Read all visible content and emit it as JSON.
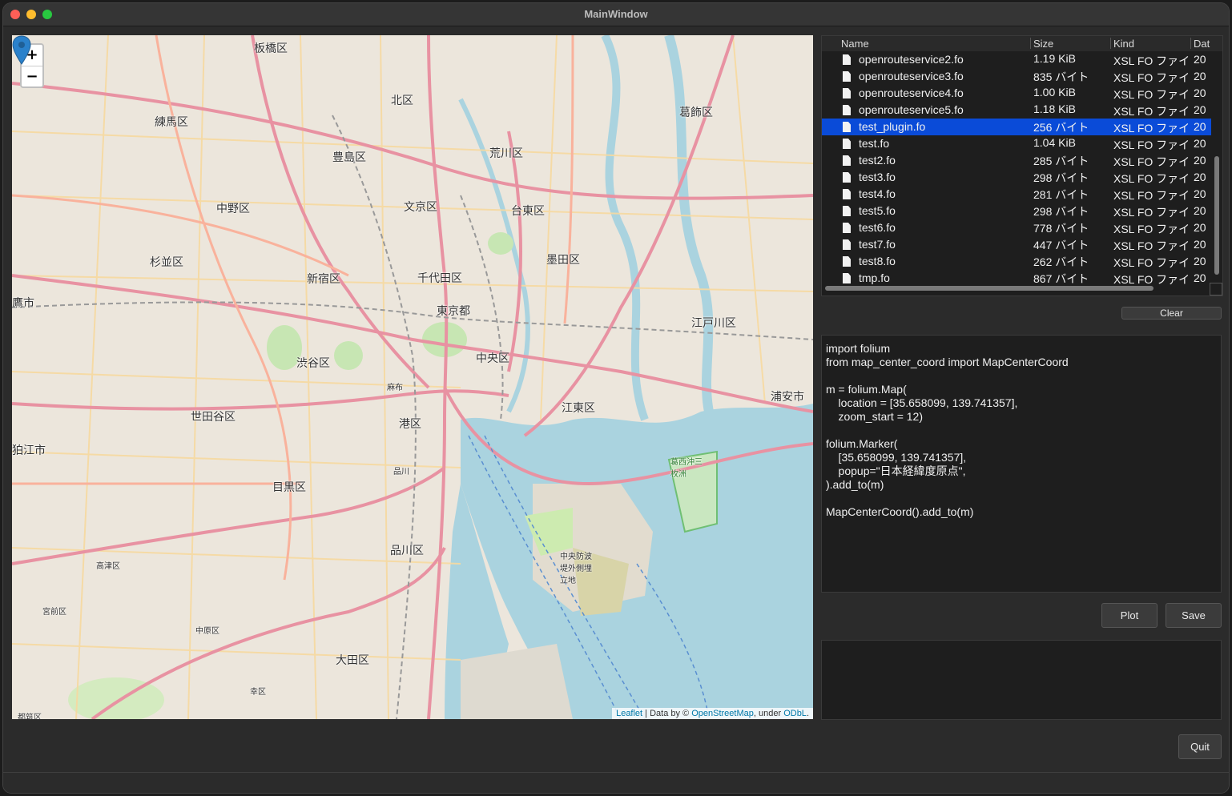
{
  "window": {
    "title": "MainWindow"
  },
  "map": {
    "zoom_in": "+",
    "zoom_out": "−",
    "labels": [
      "板橋区",
      "練馬区",
      "北区",
      "葛飾区",
      "豊島区",
      "荒川区",
      "中野区",
      "文京区",
      "台東区",
      "杉並区",
      "新宿区",
      "千代田区",
      "墨田区",
      "東京都",
      "鷹市",
      "江戸川区",
      "渋谷区",
      "中央区",
      "麻布",
      "港区",
      "江東区",
      "浦安市",
      "世田谷区",
      "狛江市",
      "目黒区",
      "品川",
      "品川区",
      "高津区",
      "宮前区",
      "中原区",
      "大田区",
      "幸区",
      "都筑区",
      "葛西沖三枚洲",
      "中央防波堤外側埋立地"
    ],
    "attribution": {
      "leaflet": "Leaflet",
      "mid": " | Data by © ",
      "osm": "OpenStreetMap",
      "under": ", under ",
      "odbl": "ODbL",
      "end": "."
    }
  },
  "file_list": {
    "columns": [
      "Name",
      "Size",
      "Kind",
      "Dat"
    ],
    "rows": [
      {
        "name": "openrouteservice2.fo",
        "size": "1.19 KiB",
        "kind": "XSL FO ファイル",
        "date": "20"
      },
      {
        "name": "openrouteservice3.fo",
        "size": "835 バイト",
        "kind": "XSL FO ファイル",
        "date": "20"
      },
      {
        "name": "openrouteservice4.fo",
        "size": "1.00 KiB",
        "kind": "XSL FO ファイル",
        "date": "20"
      },
      {
        "name": "openrouteservice5.fo",
        "size": "1.18 KiB",
        "kind": "XSL FO ファイル",
        "date": "20"
      },
      {
        "name": "test_plugin.fo",
        "size": "256 バイト",
        "kind": "XSL FO ファイル",
        "date": "20"
      },
      {
        "name": "test.fo",
        "size": "1.04 KiB",
        "kind": "XSL FO ファイル",
        "date": "20"
      },
      {
        "name": "test2.fo",
        "size": "285 バイト",
        "kind": "XSL FO ファイル",
        "date": "20"
      },
      {
        "name": "test3.fo",
        "size": "298 バイト",
        "kind": "XSL FO ファイル",
        "date": "20"
      },
      {
        "name": "test4.fo",
        "size": "281 バイト",
        "kind": "XSL FO ファイル",
        "date": "20"
      },
      {
        "name": "test5.fo",
        "size": "298 バイト",
        "kind": "XSL FO ファイル",
        "date": "20"
      },
      {
        "name": "test6.fo",
        "size": "778 バイト",
        "kind": "XSL FO ファイル",
        "date": "20"
      },
      {
        "name": "test7.fo",
        "size": "447 バイト",
        "kind": "XSL FO ファイル",
        "date": "20"
      },
      {
        "name": "test8.fo",
        "size": "262 バイト",
        "kind": "XSL FO ファイル",
        "date": "20"
      },
      {
        "name": "tmp.fo",
        "size": "867 バイト",
        "kind": "XSL FO ファイル",
        "date": "20"
      }
    ],
    "selected_index": 4
  },
  "buttons": {
    "clear": "Clear",
    "plot": "Plot",
    "save": "Save",
    "quit": "Quit"
  },
  "code_editor": {
    "text": "import folium\nfrom map_center_coord import MapCenterCoord\n\nm = folium.Map(\n    location = [35.658099, 139.741357],\n    zoom_start = 12)\n\nfolium.Marker(\n    [35.658099, 139.741357],\n    popup=\"日本経緯度原点\",\n).add_to(m)\n\nMapCenterCoord().add_to(m)"
  },
  "colors": {
    "selection": "#0a4bd8",
    "water": "#aad3df",
    "road_major": "#e892a2",
    "road_minor": "#f7d9a0",
    "marker": "#2a81cb"
  }
}
